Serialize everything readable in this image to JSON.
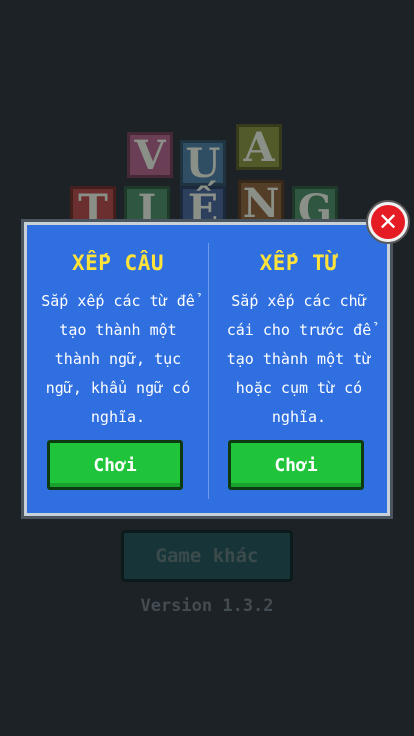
{
  "title_letters": [
    "V",
    "U",
    "A",
    "T",
    "I",
    "Ế",
    "N",
    "G"
  ],
  "background_buttons": {
    "other_games_label": "Game khác",
    "version_text": "Version 1.3.2"
  },
  "modal": {
    "left": {
      "title": "XẾP CÂU",
      "description": "Sắp xếp các từ để tạo thành một thành ngữ, tục ngữ, khẩu ngữ có nghĩa.",
      "play_label": "Chơi"
    },
    "right": {
      "title": "XẾP TỪ",
      "description": "Sắp xếp các chữ cái cho trước để tạo thành một từ hoặc cụm từ có nghĩa.",
      "play_label": "Chơi"
    },
    "close_icon": "close-icon"
  },
  "colors": {
    "modal_bg": "#2f6fe0",
    "title_yellow": "#ffe23a",
    "play_green": "#1fc43a",
    "close_red": "#e51c24"
  }
}
